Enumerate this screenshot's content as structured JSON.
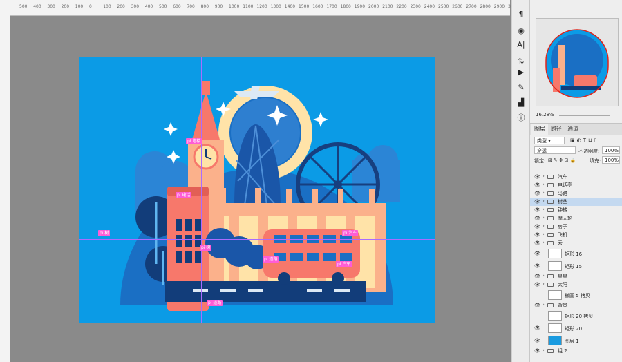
{
  "ruler": {
    "top_ticks": [
      "500",
      "400",
      "300",
      "200",
      "100",
      "0",
      "100",
      "200",
      "300",
      "400",
      "500",
      "600",
      "700",
      "800",
      "900",
      "1000",
      "1100",
      "1200",
      "1300",
      "1400",
      "1500",
      "1600",
      "1700",
      "1800",
      "1900",
      "2000",
      "2100",
      "2200",
      "2300",
      "2400",
      "2500",
      "2600",
      "2700",
      "2800",
      "2900",
      "3000"
    ]
  },
  "colors": {
    "sky": "#0b9be6",
    "circle": "#1a6fc4",
    "dark": "#123d7a",
    "salmon": "#f7786b",
    "peach": "#fbb18b",
    "cream": "#ffe3a8",
    "guide": "#a96cff",
    "tag": "#ff5cd6"
  },
  "tags": [
    "pi 塔楼",
    "pi 电话",
    "pi 树",
    "pi 树",
    "pi 汽车",
    "pi 汽车",
    "pi 道路",
    "pi 道路"
  ],
  "tools": {
    "icons": [
      "paragraph-icon",
      "layer-comp-icon",
      "character-icon",
      "adjust-icon",
      "play-icon",
      "brush-icon",
      "histogram-icon",
      "info-icon"
    ]
  },
  "navigator": {
    "zoom": "16.28%"
  },
  "panel": {
    "tabs": [
      "图层",
      "路径",
      "通道"
    ],
    "filter_label": "类型",
    "blend_mode": "穿透",
    "opacity_label": "不透明度:",
    "opacity_value": "100%",
    "lock_label": "锁定:",
    "fill_label": "填充:",
    "fill_value": "100%"
  },
  "layers": [
    {
      "name": "汽车",
      "type": "folder",
      "visible": true,
      "selected": false
    },
    {
      "name": "电话亭",
      "type": "folder",
      "visible": true,
      "selected": false
    },
    {
      "name": "马路",
      "type": "folder",
      "visible": true,
      "selected": false
    },
    {
      "name": "树丛",
      "type": "folder",
      "visible": true,
      "selected": true
    },
    {
      "name": "钟楼",
      "type": "folder",
      "visible": true,
      "selected": false
    },
    {
      "name": "摩天轮",
      "type": "folder",
      "visible": true,
      "selected": false
    },
    {
      "name": "房子",
      "type": "folder",
      "visible": true,
      "selected": false
    },
    {
      "name": "飞机",
      "type": "folder",
      "visible": true,
      "selected": false
    },
    {
      "name": "云",
      "type": "folder",
      "visible": true,
      "selected": false
    },
    {
      "name": "矩形 16",
      "type": "layer",
      "visible": true,
      "selected": false
    },
    {
      "name": "矩形 15",
      "type": "layer",
      "visible": true,
      "selected": false
    },
    {
      "name": "星星",
      "type": "folder",
      "visible": true,
      "selected": false
    },
    {
      "name": "太阳",
      "type": "folder",
      "visible": true,
      "selected": false
    },
    {
      "name": "椭圆 5 拷贝",
      "type": "layer",
      "visible": false,
      "selected": false
    },
    {
      "name": "背景",
      "type": "folder",
      "visible": true,
      "selected": false
    },
    {
      "name": "矩形 20 拷贝",
      "type": "layer",
      "visible": false,
      "selected": false
    },
    {
      "name": "矩形 20",
      "type": "layer",
      "visible": true,
      "selected": false
    },
    {
      "name": "图层 1",
      "type": "layer",
      "visible": true,
      "selected": false
    },
    {
      "name": "组 2",
      "type": "folder",
      "visible": true,
      "selected": false
    }
  ]
}
